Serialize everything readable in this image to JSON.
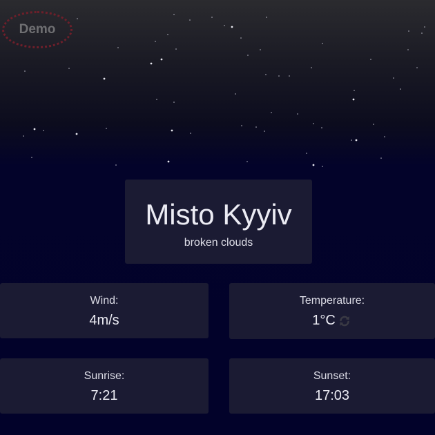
{
  "badge": {
    "label": "Demo"
  },
  "location": {
    "city": "Misto Kyyiv",
    "description": "broken clouds"
  },
  "stats": {
    "wind": {
      "label": "Wind:",
      "value": "4m/s"
    },
    "temperature": {
      "label": "Temperature:",
      "value": "1°C",
      "refresh_icon": "refresh-icon"
    },
    "sunrise": {
      "label": "Sunrise:",
      "value": "7:21"
    },
    "sunset": {
      "label": "Sunset:",
      "value": "17:03"
    }
  },
  "colors": {
    "card_background": "#1b1b33",
    "night_sky": "#02022a",
    "demo_badge_border": "#6e1f2a",
    "text": "#e4e4ee"
  }
}
